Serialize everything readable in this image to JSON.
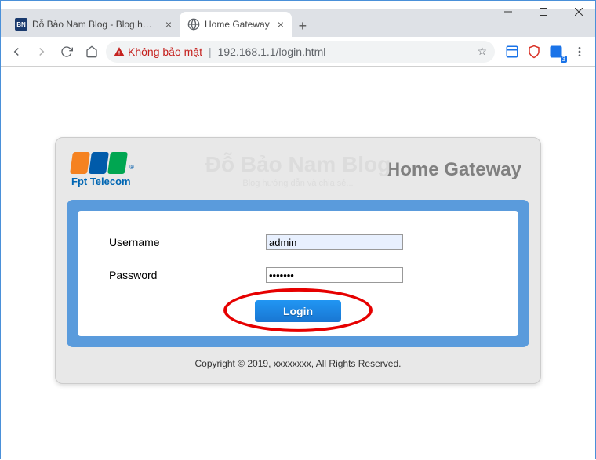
{
  "window": {
    "tabs": [
      {
        "title": "Đỗ Bảo Nam Blog - Blog hướng d",
        "favicon": "BN",
        "active": false
      },
      {
        "title": "Home Gateway",
        "favicon": "globe",
        "active": true
      }
    ]
  },
  "toolbar": {
    "insecure_label": "Không bảo mật",
    "url": "192.168.1.1/login.html"
  },
  "page": {
    "logo_sub": "Fpt Telecom",
    "watermark": "Đỗ Bảo Nam",
    "watermark_bold": "Blog",
    "watermark_sub": "Blog hướng dẫn và chia sẻ...",
    "title": "Home Gateway",
    "form": {
      "username_label": "Username",
      "username_value": "admin",
      "password_label": "Password",
      "password_value": "•••••••",
      "login_label": "Login"
    },
    "footer": "Copyright © 2019, xxxxxxxx, All Rights Reserved."
  }
}
